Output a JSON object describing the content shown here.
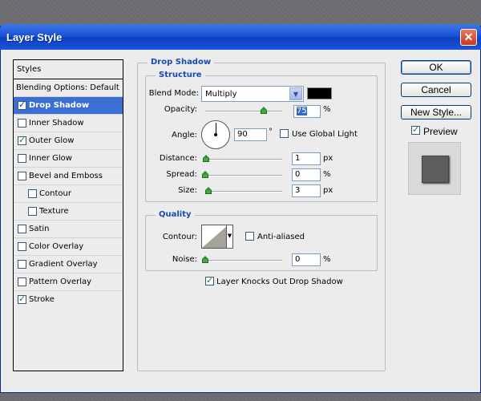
{
  "window": {
    "title": "Layer Style",
    "close_glyph": "✕"
  },
  "styles_panel": {
    "header": "Styles",
    "blending": "Blending Options: Default",
    "items": [
      {
        "label": "Drop Shadow",
        "checked": true,
        "selected": true
      },
      {
        "label": "Inner Shadow",
        "checked": false
      },
      {
        "label": "Outer Glow",
        "checked": true
      },
      {
        "label": "Inner Glow",
        "checked": false
      },
      {
        "label": "Bevel and Emboss",
        "checked": false
      },
      {
        "label": "Contour",
        "checked": false,
        "indent": true
      },
      {
        "label": "Texture",
        "checked": false,
        "indent": true
      },
      {
        "label": "Satin",
        "checked": false
      },
      {
        "label": "Color Overlay",
        "checked": false
      },
      {
        "label": "Gradient Overlay",
        "checked": false
      },
      {
        "label": "Pattern Overlay",
        "checked": false
      },
      {
        "label": "Stroke",
        "checked": true
      }
    ]
  },
  "drop_shadow": {
    "title": "Drop Shadow",
    "structure": {
      "title": "Structure",
      "blend_mode_label": "Blend Mode:",
      "blend_mode_value": "Multiply",
      "blend_color": "#000000",
      "opacity_label": "Opacity:",
      "opacity_value": "75",
      "opacity_unit": "%",
      "angle_label": "Angle:",
      "angle_value": "90",
      "angle_unit": "°",
      "global_light_label": "Use Global Light",
      "distance_label": "Distance:",
      "distance_value": "1",
      "distance_unit": "px",
      "spread_label": "Spread:",
      "spread_value": "0",
      "spread_unit": "%",
      "size_label": "Size:",
      "size_value": "3",
      "size_unit": "px"
    },
    "quality": {
      "title": "Quality",
      "contour_label": "Contour:",
      "anti_aliased_label": "Anti-aliased",
      "noise_label": "Noise:",
      "noise_value": "0",
      "noise_unit": "%"
    },
    "knockout_label": "Layer Knocks Out Drop Shadow"
  },
  "buttons": {
    "ok": "OK",
    "cancel": "Cancel",
    "new_style": "New Style...",
    "preview": "Preview"
  }
}
